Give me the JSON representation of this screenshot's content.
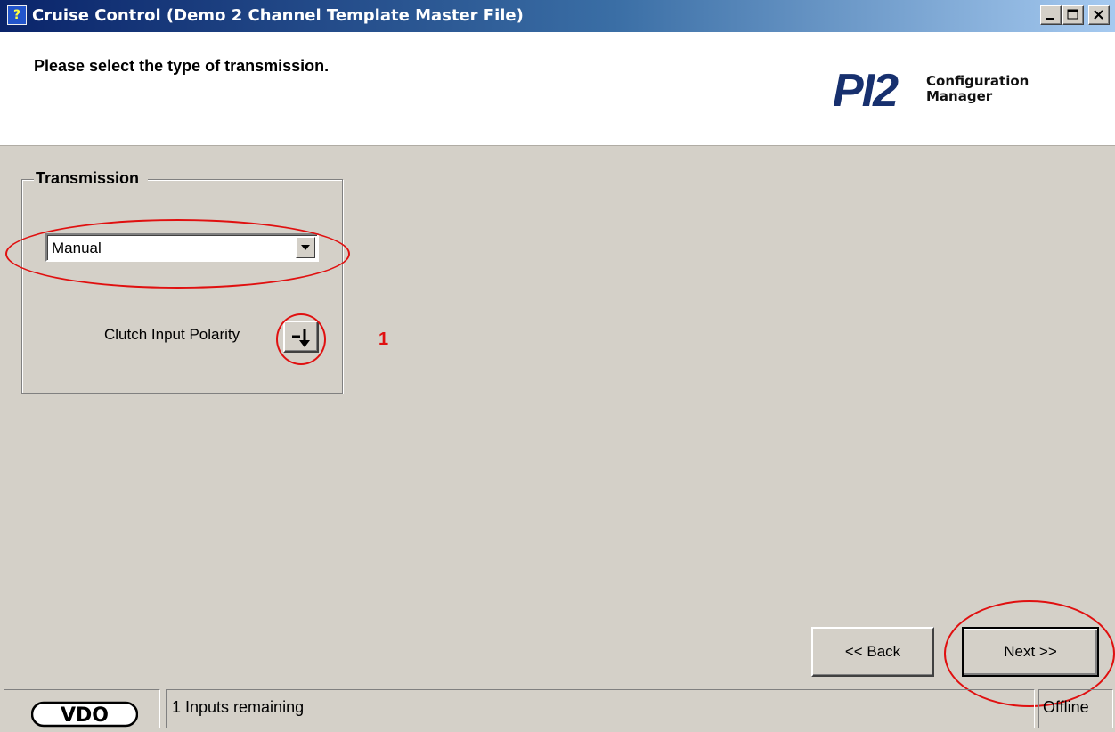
{
  "window": {
    "title": "Cruise Control (Demo 2 Channel Template Master File)",
    "controls": [
      "minimize-icon",
      "maximize-icon",
      "close-icon"
    ]
  },
  "header": {
    "instruction": "Please select the type of transmission.",
    "logo_mark": "PI2",
    "logo_line1": "Configuration",
    "logo_line2": "Manager"
  },
  "transmission": {
    "legend": "Transmission",
    "selected": "Manual",
    "clutch_label": "Clutch Input Polarity",
    "polarity_icon": "active-low-arrow-icon"
  },
  "annotation": {
    "number": "1",
    "color": "#e01010"
  },
  "navigation": {
    "back_label": "<< Back",
    "next_label": "Next >>"
  },
  "status": {
    "brand": "VDO",
    "message": "1 Inputs remaining",
    "connection": "Offline"
  },
  "colors": {
    "titlebar": "#0a246a",
    "window_bg": "#d4d0c8",
    "logo": "#17306e"
  }
}
